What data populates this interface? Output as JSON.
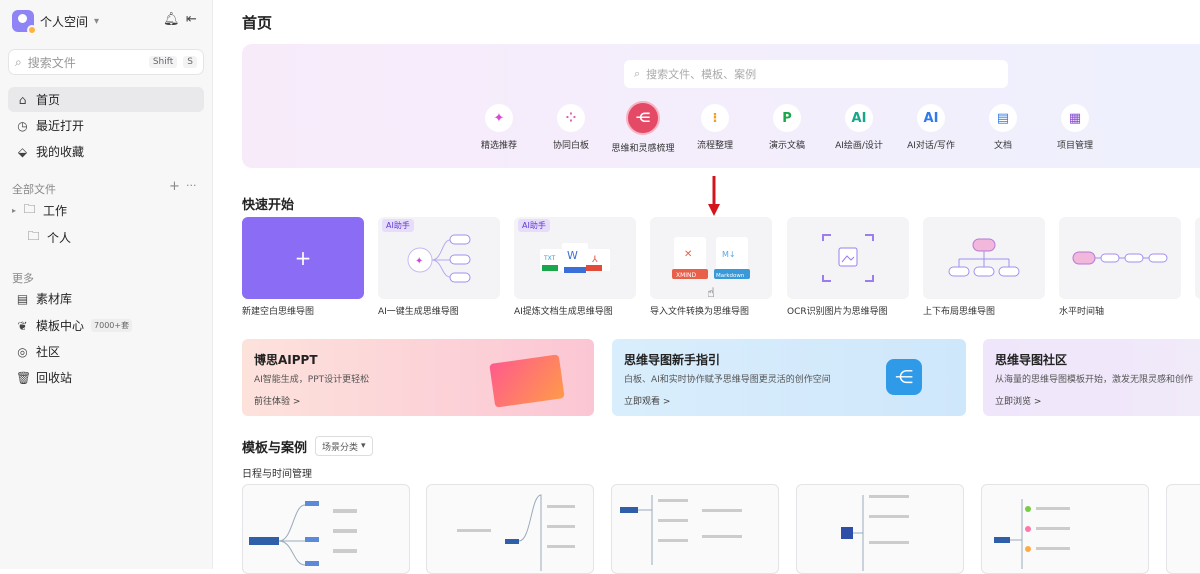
{
  "sidebar": {
    "workspace": "个人空间",
    "search_placeholder": "搜索文件",
    "shortcut": [
      "Shift",
      "S"
    ],
    "nav": [
      {
        "label": "首页",
        "icon": "home-icon"
      },
      {
        "label": "最近打开",
        "icon": "clock-icon"
      },
      {
        "label": "我的收藏",
        "icon": "tag-icon"
      }
    ],
    "files_section": "全部文件",
    "folders": [
      "工作",
      "个人"
    ],
    "more_section": "更多",
    "more": [
      {
        "label": "素材库",
        "icon": "library-icon"
      },
      {
        "label": "模板中心",
        "icon": "template-icon",
        "badge": "7000+套"
      },
      {
        "label": "社区",
        "icon": "community-icon"
      },
      {
        "label": "回收站",
        "icon": "trash-icon"
      }
    ]
  },
  "main": {
    "title": "首页",
    "search_placeholder": "搜索文件、模板、案例",
    "categories": [
      "精选推荐",
      "协同白板",
      "思维和灵感梳理",
      "流程整理",
      "演示文稿",
      "AI绘画/设计",
      "AI对话/写作",
      "文档",
      "项目管理"
    ],
    "quick_title": "快速开始",
    "ai_tag": "AI助手",
    "quick": [
      "新建空白思维导图",
      "AI一键生成思维导图",
      "AI提炼文档生成思维导图",
      "导入文件转换为思维导图",
      "OCR识别图片为思维导图",
      "上下布局思维导图",
      "水平时间轴"
    ],
    "file_badges": [
      "XMIND",
      "Markdown"
    ],
    "promos": [
      {
        "title": "博思AIPPT",
        "sub": "AI智能生成，PPT设计更轻松",
        "link": "前往体验 >"
      },
      {
        "title": "思维导图新手指引",
        "sub": "白板、AI和实时协作赋予思维导图更灵活的创作空间",
        "link": "立即观看 >"
      },
      {
        "title": "思维导图社区",
        "sub": "从海量的思维导图模板开始，激发无限灵感和创作",
        "link": "立即浏览 >"
      }
    ],
    "templates_title": "模板与案例",
    "filter": "场景分类",
    "templates_sub": "日程与时间管理"
  },
  "colors": {
    "accent": "#8a6cf5",
    "selected_category": "#e44a66",
    "arrow": "#d4141c"
  }
}
